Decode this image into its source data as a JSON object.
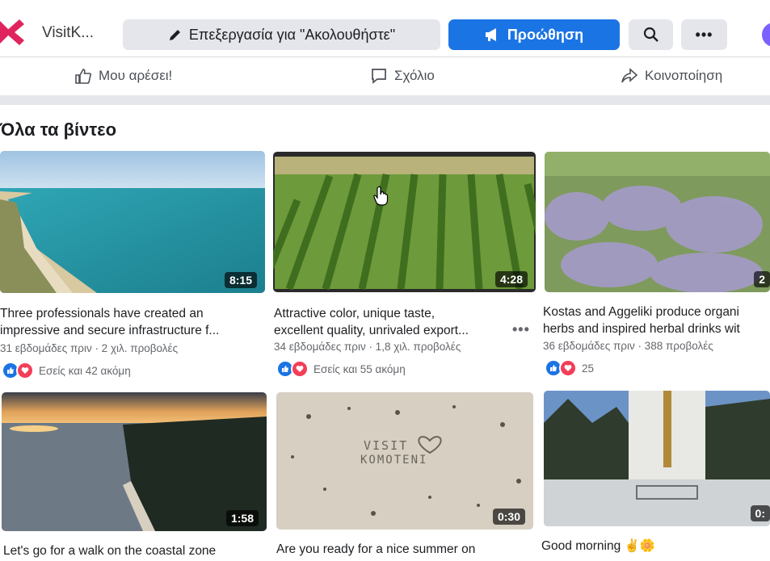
{
  "header": {
    "page_name": "VisitK...",
    "edit_label": "Επεξεργασία για \"Ακολουθήστε\"",
    "promote_label": "Προώθηση",
    "more_label": "•••"
  },
  "actions": {
    "like_label": "Μου αρέσει!",
    "comment_label": "Σχόλιο",
    "share_label": "Κοινοποίηση"
  },
  "section": {
    "title": "Όλα τα βίντεο"
  },
  "videos": [
    {
      "title_line1": "Three professionals have created an",
      "title_line2": "impressive and secure infrastructure f...",
      "meta": "31 εβδομάδες πριν · 2 χιλ. προβολές",
      "reactions": "Εσείς και 42 ακόμη",
      "duration": "8:15"
    },
    {
      "title_line1": "Attractive color, unique taste,",
      "title_line2": "excellent quality, unrivaled export...",
      "meta": "34 εβδομάδες πριν · 1,8 χιλ. προβολές",
      "reactions": "Εσείς και 55 ακόμη",
      "duration": "4:28",
      "more": "•••"
    },
    {
      "title_line1": "Kostas and Aggeliki produce organi",
      "title_line2": "herbs and inspired herbal drinks wit",
      "meta": "36 εβδομάδες πριν · 388 προβολές",
      "reactions": "25",
      "duration": "2"
    },
    {
      "title_line1": "Let's go for a walk on the coastal zone",
      "duration": "1:58"
    },
    {
      "title_line1": "Are you ready for a nice summer on",
      "duration": "0:30",
      "thumb_text_1": "VISIT",
      "thumb_text_2": "KOMOTENI"
    },
    {
      "title_line1": "Good morning ✌🌼",
      "duration": "0:"
    }
  ],
  "colors": {
    "brand_blue": "#1b74e4",
    "love_red": "#f33e58",
    "secondary_text": "#65676b"
  }
}
